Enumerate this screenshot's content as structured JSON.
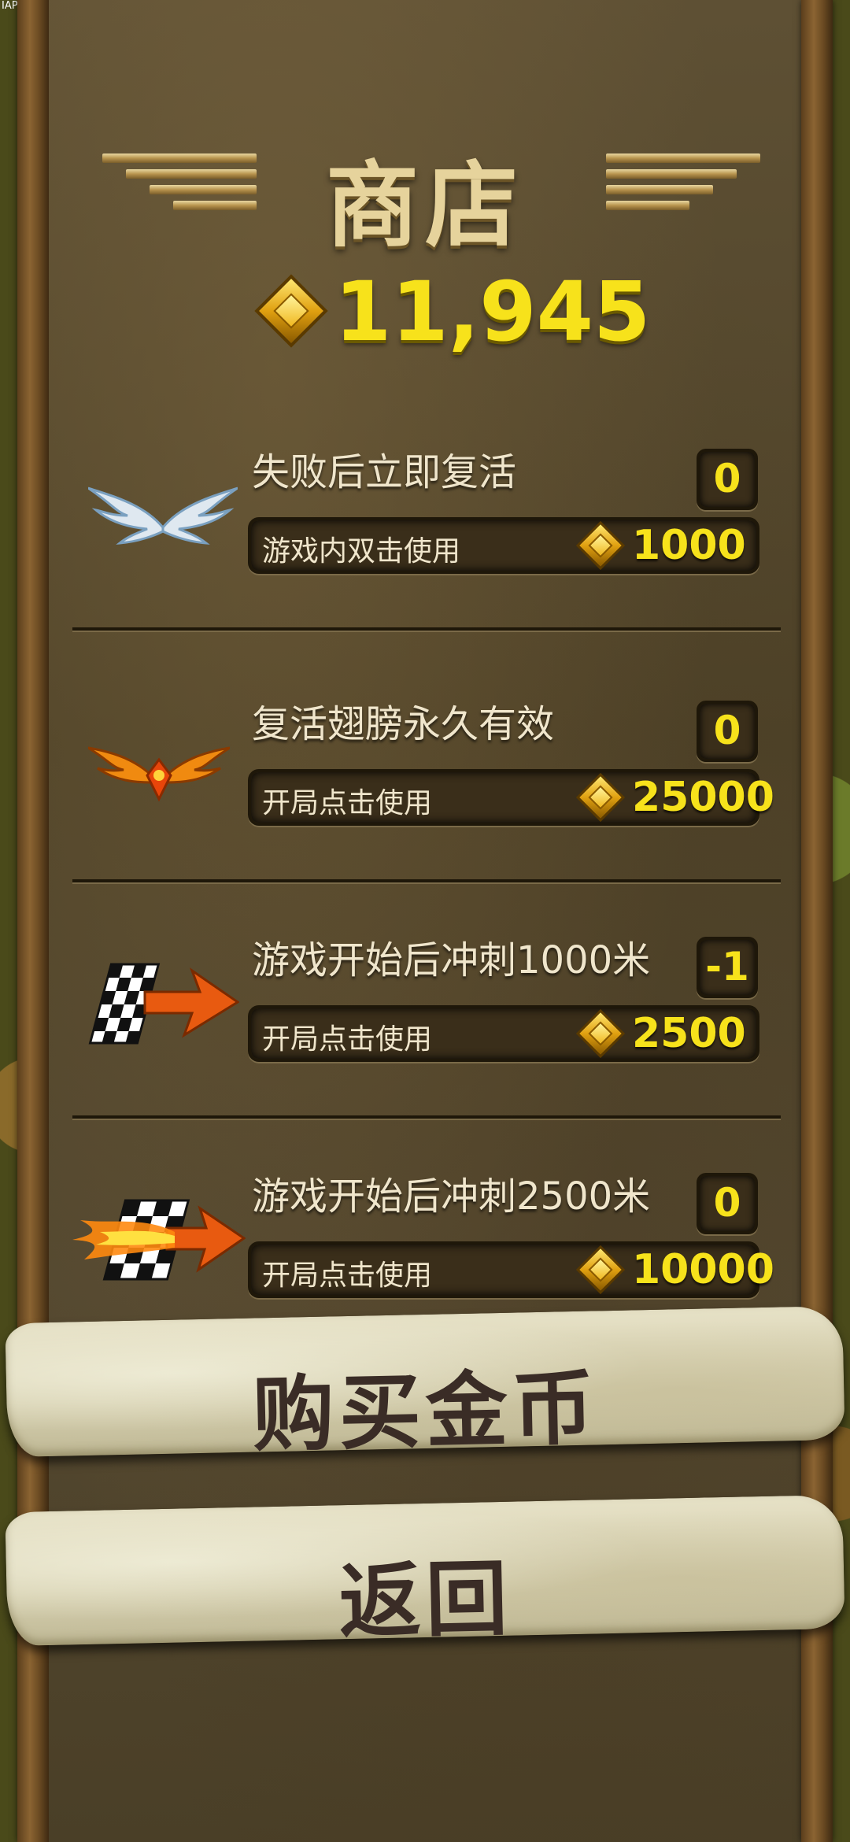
{
  "debug_label": "IAP Start",
  "title": "商店",
  "balance": "11,945",
  "items": [
    {
      "name": "失败后立即复活",
      "count": "0",
      "action": "游戏内双击使用",
      "price": "1000",
      "icon": "silver-wings-icon"
    },
    {
      "name": "复活翅膀永久有效",
      "count": "0",
      "action": "开局点击使用",
      "price": "25000",
      "icon": "fire-wings-icon"
    },
    {
      "name": "游戏开始后冲刺1000米",
      "count": "-1",
      "action": "开局点击使用",
      "price": "2500",
      "icon": "checkered-flag-arrow-icon"
    },
    {
      "name": "游戏开始后冲刺2500米",
      "count": "0",
      "action": "开局点击使用",
      "price": "10000",
      "icon": "flaming-flag-arrow-icon"
    }
  ],
  "buttons": {
    "buy_coins": "购买金币",
    "back": "返回"
  },
  "colors": {
    "gold_text": "#f7e21b",
    "panel": "#544830",
    "scroll": "#e6e1c6"
  }
}
